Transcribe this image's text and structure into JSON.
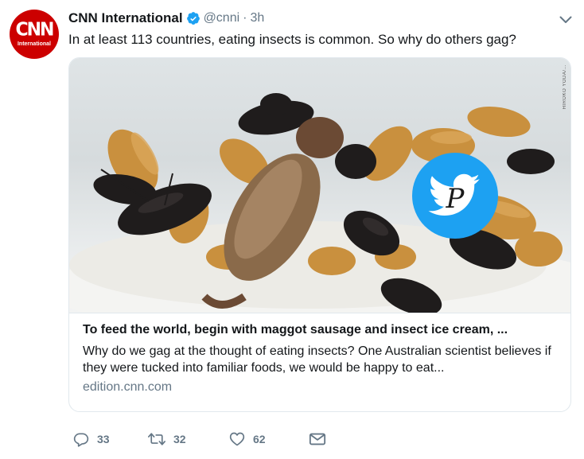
{
  "account": {
    "name": "CNN International",
    "handle": "@cnni",
    "separator": "·",
    "time": "3h",
    "avatar_logo": "CNN",
    "avatar_sub": "International",
    "verified": true
  },
  "tweet": {
    "text": "In at least 113 countries, eating insects is common. So why do others gag?"
  },
  "card": {
    "photo_credit": "HIROKO YODA/...",
    "title": "To feed the world, begin with maggot sausage and insect ice cream, ...",
    "description": "Why do we gag at the thought of eating insects? One Australian scientist believes if they were tucked into familiar foods, we would be happy to eat...",
    "domain": "edition.cnn.com"
  },
  "actions": {
    "replies": "33",
    "retweets": "32",
    "likes": "62"
  },
  "colors": {
    "brand_red": "#cc0000",
    "verified_blue": "#1da1f2",
    "muted_text": "#657786",
    "border": "#e1e8ed"
  },
  "icons": [
    "verified-badge-icon",
    "chevron-down-icon",
    "reply-icon",
    "retweet-icon",
    "like-icon",
    "direct-message-icon",
    "twitter-bird-watermark-icon"
  ]
}
